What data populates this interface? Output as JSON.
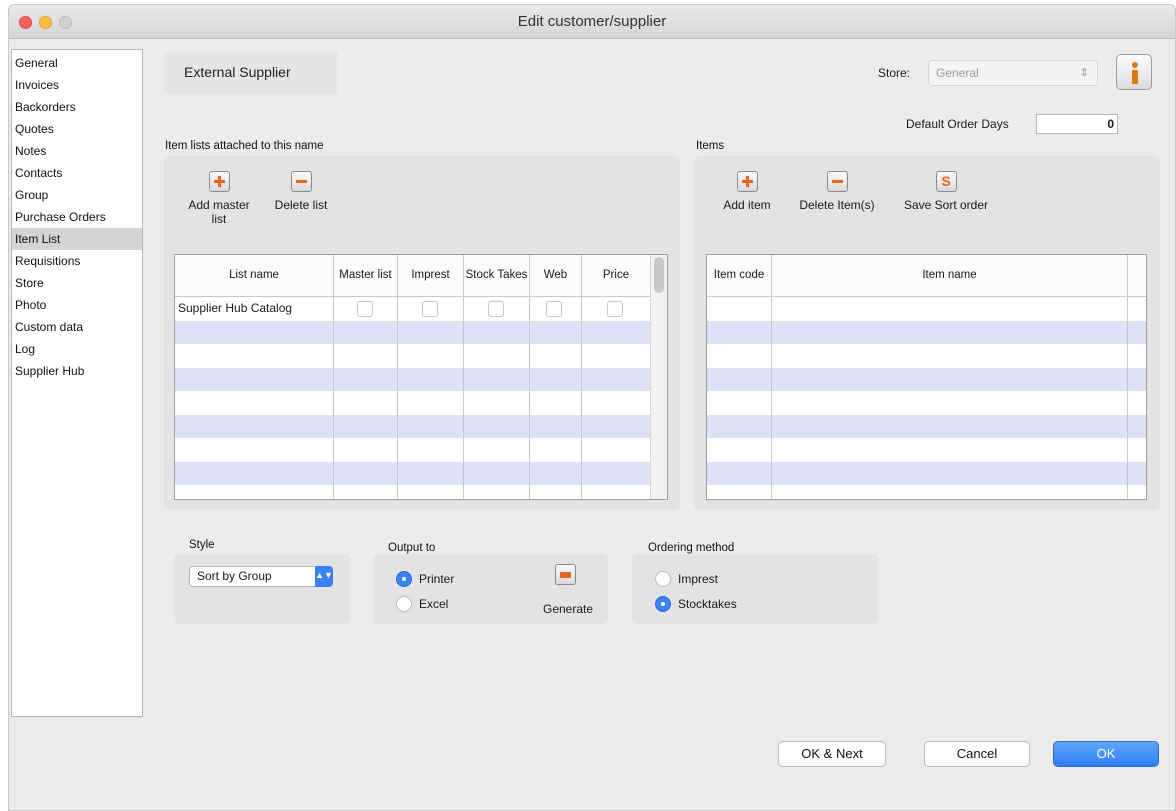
{
  "window": {
    "title": "Edit customer/supplier"
  },
  "sidebar": {
    "items": [
      {
        "label": "General"
      },
      {
        "label": "Invoices"
      },
      {
        "label": "Backorders"
      },
      {
        "label": "Quotes"
      },
      {
        "label": "Notes"
      },
      {
        "label": "Contacts"
      },
      {
        "label": "Group"
      },
      {
        "label": "Purchase Orders"
      },
      {
        "label": "Item List",
        "active": true
      },
      {
        "label": "Requisitions"
      },
      {
        "label": "Store"
      },
      {
        "label": "Photo"
      },
      {
        "label": "Custom data"
      },
      {
        "label": "Log"
      },
      {
        "label": "Supplier Hub"
      }
    ]
  },
  "header": {
    "title": "External Supplier",
    "store_label": "Store:",
    "store_value": "General",
    "default_order_days_label": "Default Order Days",
    "default_order_days_value": "0"
  },
  "item_lists": {
    "group_label": "Item lists attached to this name",
    "add_label": "Add master list",
    "delete_label": "Delete list",
    "columns": [
      "List name",
      "Master list",
      "Imprest",
      "Stock Takes",
      "Web",
      "Price"
    ],
    "rows": [
      {
        "list_name": "Supplier Hub Catalog",
        "master": false,
        "imprest": false,
        "stocktakes": false,
        "web": false,
        "price": false
      }
    ]
  },
  "items": {
    "group_label": "Items",
    "add_label": "Add item",
    "delete_label": "Delete Item(s)",
    "save_sort_label": "Save Sort order",
    "columns": [
      "Item code",
      "Item name"
    ],
    "rows": []
  },
  "style": {
    "label": "Style",
    "value": "Sort by Group"
  },
  "output": {
    "label": "Output to",
    "options": [
      "Printer",
      "Excel"
    ],
    "selected": "Printer",
    "generate_label": "Generate"
  },
  "ordering": {
    "label": "Ordering method",
    "options": [
      "Imprest",
      "Stocktakes"
    ],
    "selected": "Stocktakes"
  },
  "footer": {
    "ok_next": "OK & Next",
    "cancel": "Cancel",
    "ok": "OK"
  },
  "colors": {
    "accent": "#3b82f6",
    "row_alt": "#dfe2f7",
    "icon_orange": "#e9651a"
  }
}
